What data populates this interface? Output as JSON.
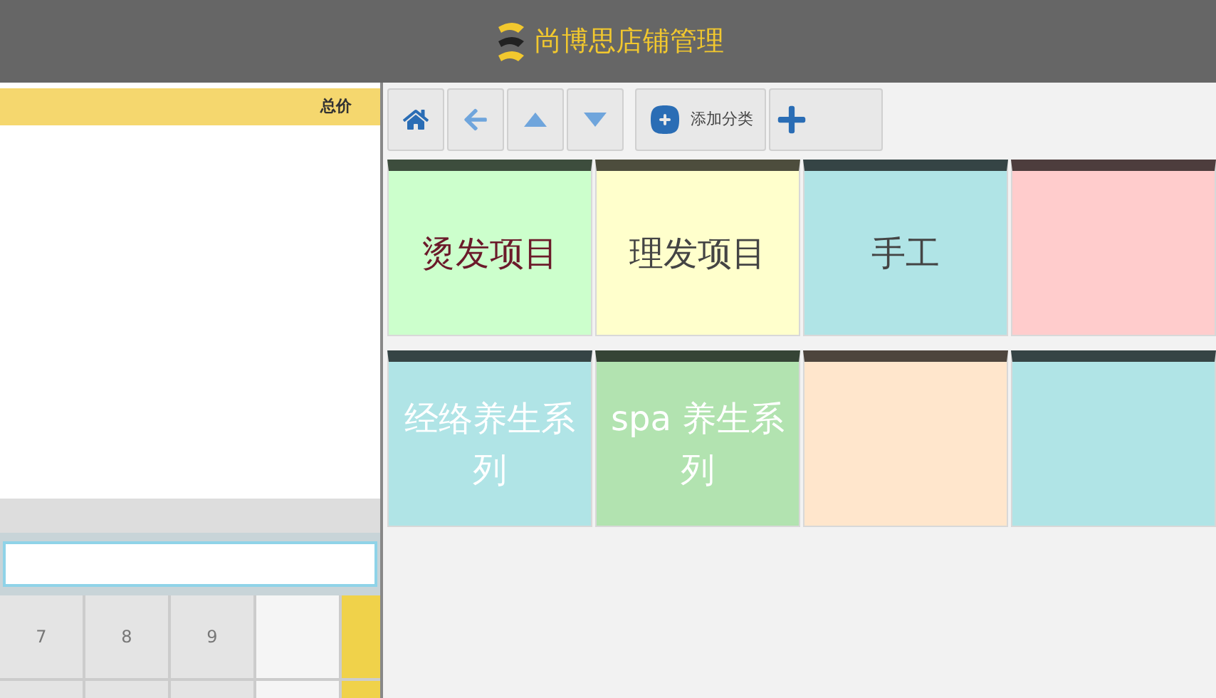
{
  "header": {
    "title": "尚博思店铺管理"
  },
  "order_table": {
    "columns": [
      "总价"
    ]
  },
  "toolbar": {
    "buttons": [
      {
        "kind": "home"
      },
      {
        "kind": "back"
      },
      {
        "kind": "up"
      },
      {
        "kind": "down"
      },
      {
        "kind": "add-category",
        "label": "添加分类"
      },
      {
        "kind": "add"
      }
    ]
  },
  "tiles": [
    {
      "label": "烫发项目",
      "color": "#ccffcc",
      "kind": "accent"
    },
    {
      "label": "理发项目",
      "color": "#ffffcc",
      "kind": "dark"
    },
    {
      "label": "手工",
      "color": "#b0e4e6",
      "kind": "dark"
    },
    {
      "color": "#ffcccc"
    },
    {
      "label": "经络养生系列",
      "color": "#b0e4e6",
      "kind": "light"
    },
    {
      "label": "spa 养生系列",
      "color": "#b2e3b0",
      "kind": "light"
    },
    {
      "color": "#ffe6cc"
    },
    {
      "color": "#b0e4e6"
    }
  ],
  "keypad": {
    "keys": [
      {
        "label": "7"
      },
      {
        "label": "8"
      },
      {
        "label": "9"
      }
    ]
  }
}
